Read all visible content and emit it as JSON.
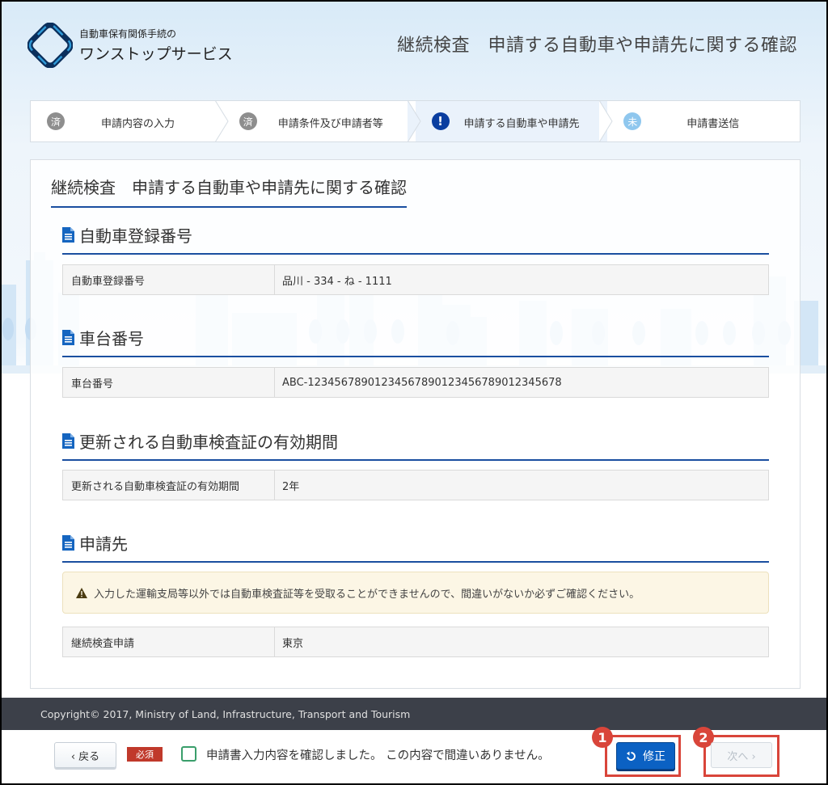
{
  "header": {
    "logo_small": "自動車保有関係手続の",
    "logo_big": "ワンストップサービス",
    "page_heading": "継続検査　申請する自動車や申請先に関する確認"
  },
  "steps": [
    {
      "badge": "済",
      "label": "申請内容の入力",
      "state": "done"
    },
    {
      "badge": "済",
      "label": "申請条件及び申請者等",
      "state": "done"
    },
    {
      "badge": "!",
      "label": "申請する自動車や申請先",
      "state": "current"
    },
    {
      "badge": "未",
      "label": "申請書送信",
      "state": "todo"
    }
  ],
  "panel": {
    "title": "継続検査　申請する自動車や申請先に関する確認",
    "sections": [
      {
        "title": "自動車登録番号",
        "rows": [
          {
            "key": "自動車登録番号",
            "value": "品川 - 334 - ね - 1111"
          }
        ]
      },
      {
        "title": "車台番号",
        "rows": [
          {
            "key": "車台番号",
            "value": "ABC-12345678901234567890123456789012345678"
          }
        ]
      },
      {
        "title": "更新される自動車検査証の有効期間",
        "rows": [
          {
            "key": "更新される自動車検査証の有効期間",
            "value": "2年"
          }
        ]
      },
      {
        "title": "申請先",
        "warning": "入力した運輸支局等以外では自動車検査証等を受取ることができませんので、間違いがないか必ずご確認ください。",
        "rows": [
          {
            "key": "継続検査申請",
            "value": "東京"
          }
        ]
      }
    ]
  },
  "footer": {
    "copyright": "Copyright© 2017, Ministry of Land, Infrastructure, Transport and Tourism"
  },
  "bottom": {
    "back_label": "‹ 戻る",
    "required_label": "必須",
    "confirm_text": "申請書入力内容を確認しました。 この内容で間違いありません。",
    "fix_label": "修正",
    "next_label": "次へ ›",
    "callout_1": "1",
    "callout_2": "2"
  },
  "colors": {
    "accent": "#1a4fa0",
    "primary_button": "#0b61c3",
    "callout": "#d9453a",
    "footer_bg": "#3c4049"
  }
}
